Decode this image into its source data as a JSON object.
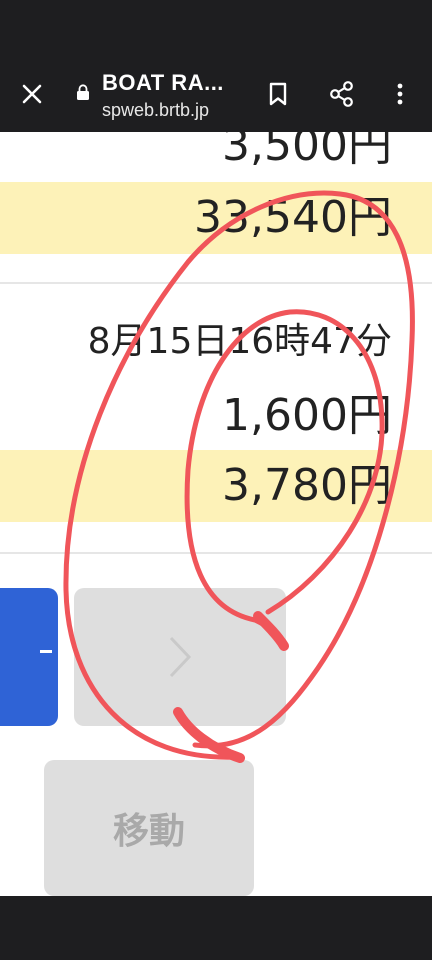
{
  "browser": {
    "title": "BOAT RA...",
    "url": "spweb.brtb.jp"
  },
  "records": {
    "top_amount": "3,500円",
    "top_total": "33,540円",
    "entry": {
      "datetime": "8月15日16時47分",
      "amount": "1,600円",
      "total": "3,780円"
    }
  },
  "actions": {
    "move_label": "移動"
  },
  "icons": {
    "close": "close-icon",
    "lock": "lock-icon",
    "bookmark": "bookmark-icon",
    "share": "share-icon",
    "menu": "more-vert-icon",
    "next": "chevron-right-icon"
  },
  "colors": {
    "highlight_row": "#fdf2b8",
    "blue_button": "#2f63d6",
    "annotation_stroke": "#f0555a"
  }
}
